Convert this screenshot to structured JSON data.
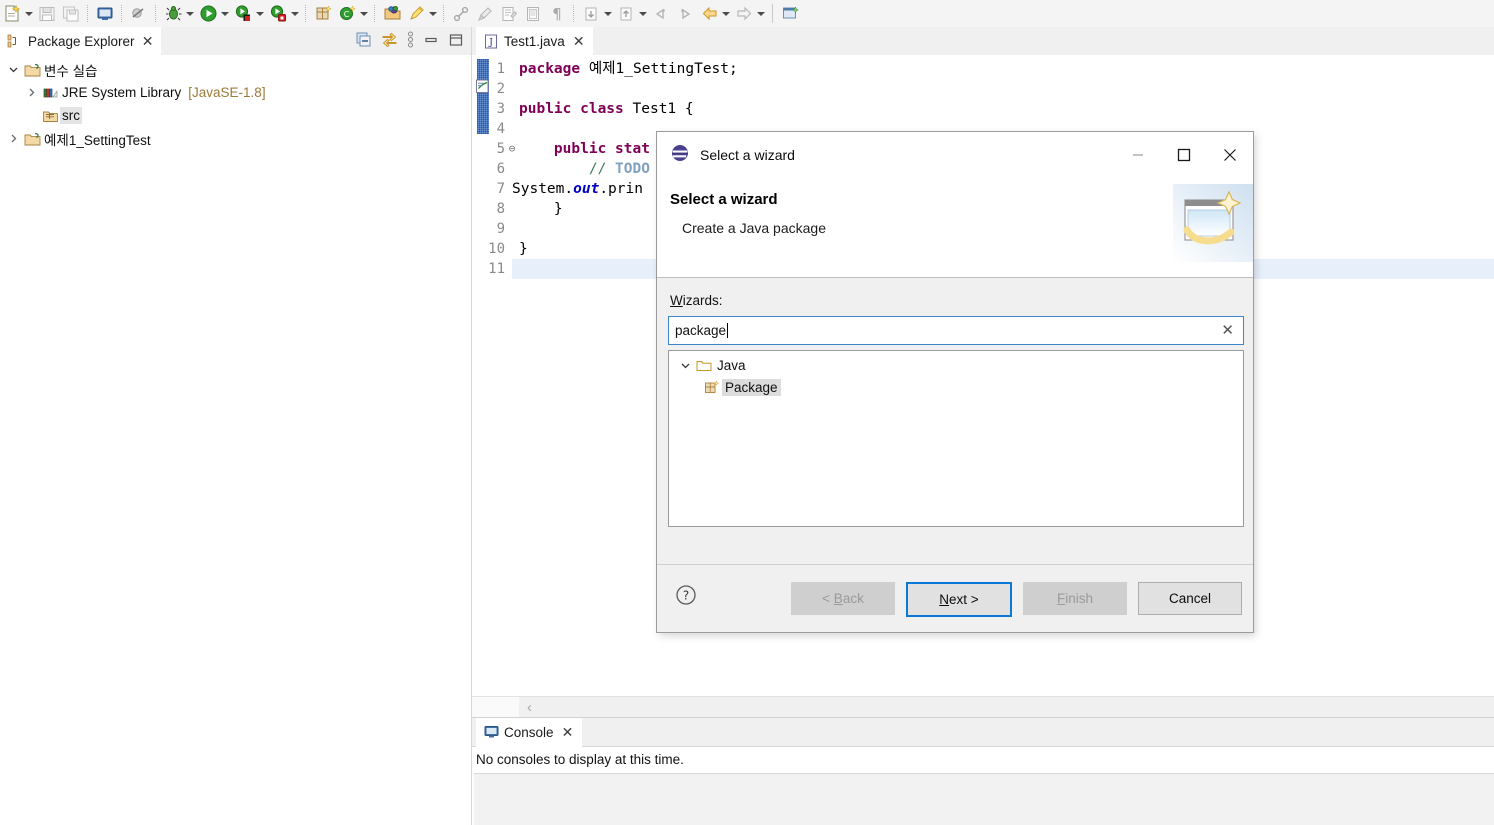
{
  "toolbar": {
    "items": [
      {
        "name": "new-wizard-icon",
        "arrow": true
      },
      {
        "name": "save-icon",
        "arrow": false
      },
      {
        "name": "save-all-icon",
        "arrow": false
      },
      {
        "name": "sep",
        "arrow": false
      },
      {
        "name": "console-icon",
        "arrow": false
      },
      {
        "name": "sep",
        "arrow": false
      },
      {
        "name": "skip-breakpoints-icon",
        "arrow": false
      },
      {
        "name": "sep",
        "arrow": false
      },
      {
        "name": "debug-icon",
        "arrow": true
      },
      {
        "name": "run-icon",
        "arrow": true
      },
      {
        "name": "run-coverage-icon",
        "arrow": true
      },
      {
        "name": "external-tools-icon",
        "arrow": true
      },
      {
        "name": "sep",
        "arrow": false
      },
      {
        "name": "new-java-package-icon",
        "arrow": false
      },
      {
        "name": "new-java-class-icon",
        "arrow": true
      },
      {
        "name": "sep",
        "arrow": false
      },
      {
        "name": "open-type-icon",
        "arrow": false
      },
      {
        "name": "search-icon",
        "arrow": true
      },
      {
        "name": "sep",
        "arrow": false
      },
      {
        "name": "link-icon",
        "arrow": false
      },
      {
        "name": "clean-icon",
        "arrow": false
      },
      {
        "name": "annotate-icon",
        "arrow": false
      },
      {
        "name": "show-whitespace-icon",
        "arrow": false
      },
      {
        "name": "pilcrow-icon",
        "arrow": false
      },
      {
        "name": "sep",
        "arrow": false
      },
      {
        "name": "previous-annotation-icon",
        "arrow": true
      },
      {
        "name": "next-annotation-icon",
        "arrow": true
      },
      {
        "name": "last-edit-location-icon",
        "arrow": false
      },
      {
        "name": "forward-edit-icon",
        "arrow": false
      },
      {
        "name": "back-navigation-icon",
        "arrow": true
      },
      {
        "name": "forward-navigation-icon",
        "arrow": true
      },
      {
        "name": "sep-solid",
        "arrow": false
      },
      {
        "name": "open-perspective-icon",
        "arrow": false
      }
    ]
  },
  "package_explorer": {
    "tab_title": "Package Explorer",
    "tools": [
      "collapse-all-icon",
      "link-with-editor-icon",
      "view-menu-icon",
      "minimize-icon",
      "maximize-icon"
    ],
    "tree": [
      {
        "label": "변수 실습",
        "icon": "java-project-icon",
        "arrow": "expanded",
        "indent": 0,
        "selected": false
      },
      {
        "label": "JRE System Library",
        "suffix": "[JavaSE-1.8]",
        "icon": "library-icon",
        "arrow": "collapsed",
        "indent": 1,
        "selected": false
      },
      {
        "label": "src",
        "icon": "source-folder-icon",
        "arrow": "none",
        "indent": 1,
        "selected": true
      },
      {
        "label": "예제1_SettingTest",
        "icon": "java-project-icon",
        "arrow": "collapsed",
        "indent": 0,
        "selected": false
      }
    ]
  },
  "editor": {
    "tab_title": "Test1.java",
    "tab_icon": "java-file-icon",
    "tab_close": "×",
    "current_line": 11,
    "lines": [
      {
        "num": "1",
        "fold": "",
        "tokens": [
          {
            "t": "package ",
            "c": "kw"
          },
          {
            "t": "예제1_SettingTest;",
            "c": "pl"
          }
        ]
      },
      {
        "num": "2",
        "fold": "",
        "tokens": []
      },
      {
        "num": "3",
        "fold": "",
        "tokens": [
          {
            "t": "public class ",
            "c": "kw"
          },
          {
            "t": "Test1 {",
            "c": "pl"
          }
        ]
      },
      {
        "num": "4",
        "fold": "",
        "tokens": []
      },
      {
        "num": "5",
        "fold": "⊖",
        "tokens": [
          {
            "t": "    ",
            "c": "pl"
          },
          {
            "t": "public stat",
            "c": "kw"
          }
        ]
      },
      {
        "num": "6",
        "fold": "",
        "tokens": [
          {
            "t": "        ",
            "c": "pl"
          },
          {
            "t": "// ",
            "c": "cm"
          },
          {
            "t": "TODO",
            "c": "todo"
          }
        ]
      },
      {
        "num": "7",
        "fold": "",
        "tokens": [
          {
            "t": "System.",
            "c": "pl"
          },
          {
            "t": "out",
            "c": "fld"
          },
          {
            "t": ".prin",
            "c": "pl"
          }
        ]
      },
      {
        "num": "8",
        "fold": "",
        "tokens": [
          {
            "t": "    }",
            "c": "pl"
          }
        ]
      },
      {
        "num": "9",
        "fold": "",
        "tokens": []
      },
      {
        "num": "10",
        "fold": "",
        "tokens": [
          {
            "t": "}",
            "c": "pl"
          }
        ]
      },
      {
        "num": "11",
        "fold": "",
        "tokens": []
      }
    ],
    "hscroll_arrow": "‹"
  },
  "console": {
    "tab_title": "Console",
    "tab_icon": "console-icon",
    "tab_close": "×",
    "message": "No consoles to display at this time."
  },
  "dialog": {
    "window_title": "Select a wizard",
    "window_icon": "eclipse-icon",
    "minimize_label": "—",
    "maximize_label": "☐",
    "close_label": "✕",
    "header_title": "Select a wizard",
    "header_subtitle": "Create a Java package",
    "banner_icon": "wizard-banner-icon",
    "wizards_label_prefix": "W",
    "wizards_label_rest": "izards:",
    "search_value": "package",
    "search_clear_icon": "clear-icon",
    "tree": [
      {
        "label": "Java",
        "icon": "folder-icon",
        "arrow": "expanded",
        "indent": 0,
        "selected": false
      },
      {
        "label": "Package",
        "icon": "package-icon",
        "arrow": "none",
        "indent": 1,
        "selected": true
      }
    ],
    "help_icon": "help-icon",
    "buttons": [
      {
        "label_pre": "< ",
        "label_key": "B",
        "label_post": "ack",
        "state": "disabled",
        "name": "back-button"
      },
      {
        "label_pre": "",
        "label_key": "N",
        "label_post": "ext >",
        "state": "default",
        "name": "next-button"
      },
      {
        "label_pre": "",
        "label_key": "F",
        "label_post": "inish",
        "state": "disabled",
        "name": "finish-button"
      },
      {
        "label_pre": "",
        "label_key": "",
        "label_post": "Cancel",
        "state": "enabled",
        "name": "cancel-button"
      }
    ]
  },
  "colors": {
    "accent": "#0a78d7",
    "keyword": "#7f0055",
    "comment": "#3f7f5f",
    "todo": "#7f9fbf",
    "field": "#0000c0",
    "current_line": "#e7effb",
    "chrome": "#f0f0f0"
  }
}
